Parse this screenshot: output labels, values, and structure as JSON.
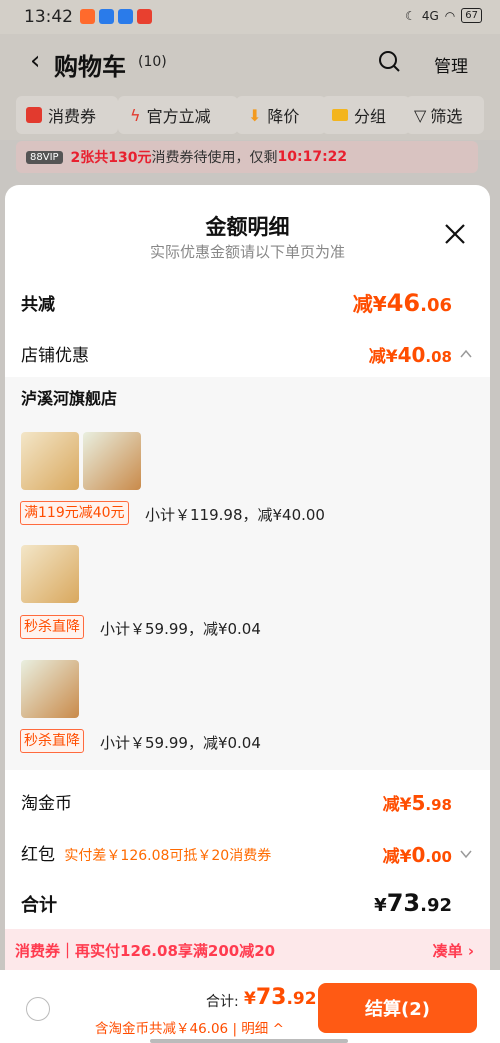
{
  "status_bar": {
    "time": "13:42",
    "signal": "4G",
    "battery": "67"
  },
  "header": {
    "back_icon": "chevron-left-icon",
    "title": "购物车",
    "count": "(10)",
    "search_icon": "search-icon",
    "manage_label": "管理"
  },
  "filters": [
    {
      "label": "消费券",
      "icon": "coupon-icon"
    },
    {
      "label": "官方立减",
      "icon": "lightning-icon"
    },
    {
      "label": "降价",
      "icon": "price-drop-icon"
    },
    {
      "label": "分组",
      "icon": "folder-icon"
    },
    {
      "label": "筛选",
      "icon": "filter-icon"
    }
  ],
  "notice": {
    "vip": "88VIP",
    "part1": "2张共130元",
    "part2": "消费券待使用，仅剩",
    "countdown": "10:17:22"
  },
  "sheet": {
    "title": "金额明细",
    "subtitle": "实际优惠金额请以下单页为准",
    "total_discount_label": "共减",
    "total_discount": {
      "prefix": "减¥",
      "int": "46",
      "dec": ".06"
    },
    "shop_discount_label": "店铺优惠",
    "shop_discount": {
      "prefix": "减¥",
      "int": "40",
      "dec": ".08"
    },
    "shop_name": "泸溪河旗舰店",
    "items": [
      {
        "tag": "满119元减40元",
        "subtotal": "小计￥119.98，减¥40.00"
      },
      {
        "tag": "秒杀直降",
        "subtotal": "小计￥59.99，减¥0.04"
      },
      {
        "tag": "秒杀直降",
        "subtotal": "小计￥59.99，减¥0.04"
      }
    ],
    "coin_label": "淘金币",
    "coin_discount": {
      "prefix": "减¥",
      "int": "5",
      "dec": ".98"
    },
    "redpacket_label": "红包",
    "redpacket_note": "实付差￥126.08可抵￥20消费券",
    "redpacket_discount": {
      "prefix": "减¥",
      "int": "0",
      "dec": ".00"
    },
    "total_label": "合计",
    "total_amount": {
      "prefix": "¥",
      "int": "73",
      "dec": ".92"
    }
  },
  "promo_bar": {
    "left": "消费券｜再实付126.08享满200减20",
    "right": "凑单 ›"
  },
  "footer": {
    "total_label": "合计:",
    "total_prefix": "¥",
    "total_int": "73",
    "total_dec": ".92",
    "detail": "含淘金币共减￥46.06 | 明细 ^",
    "checkout": "结算(2)"
  },
  "colors": {
    "accent": "#ff4d00",
    "checkout": "#ff5a14",
    "promo": "#ff3b4f"
  }
}
